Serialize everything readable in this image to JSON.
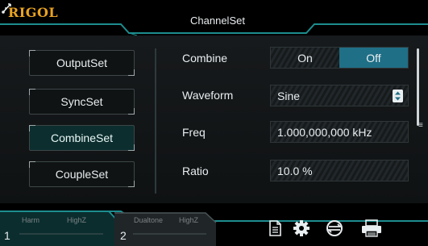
{
  "header": {
    "logo": "RIGOL",
    "title": "ChannelSet",
    "status_icon": "usb-icon"
  },
  "menu": {
    "items": [
      {
        "label": "OutputSet",
        "active": false
      },
      {
        "label": "SyncSet",
        "active": false
      },
      {
        "label": "CombineSet",
        "active": true
      },
      {
        "label": "CoupleSet",
        "active": false
      }
    ]
  },
  "settings": {
    "combine": {
      "label": "Combine",
      "on": "On",
      "off": "Off",
      "selected": "Off"
    },
    "waveform": {
      "label": "Waveform",
      "value": "Sine"
    },
    "freq": {
      "label": "Freq",
      "value": "1.000,000,000 kHz"
    },
    "ratio": {
      "label": "Ratio",
      "value": "10.0 %"
    }
  },
  "channels": [
    {
      "number": "1",
      "mode": "Harm",
      "impedance": "HighZ",
      "active": true
    },
    {
      "number": "2",
      "mode": "Dualtone",
      "impedance": "HighZ",
      "active": false
    }
  ],
  "toolbar": {
    "icons": [
      "document-icon",
      "gear-icon",
      "sync-arrows-icon",
      "printer-icon"
    ]
  },
  "colors": {
    "accent": "#2a8a8a",
    "logo": "#e8a222",
    "selected_toggle": "#1f6f86",
    "active_menu": "#0c2e2e"
  }
}
